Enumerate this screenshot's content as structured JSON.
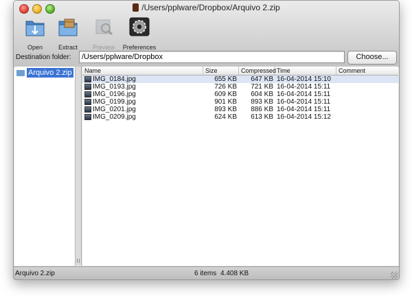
{
  "window": {
    "title": "/Users/pplware/Dropbox/Arquivo 2.zip"
  },
  "toolbar": {
    "open": "Open",
    "extract": "Extract",
    "preview": "Preview",
    "preferences": "Preferences"
  },
  "destination": {
    "label": "Destination folder:",
    "value": "/Users/pplware/Dropbox",
    "choose": "Choose..."
  },
  "sidebar": {
    "items": [
      {
        "label": "Arquivo 2.zip",
        "icon": "folder-icon"
      }
    ]
  },
  "columns": {
    "name": "Name",
    "size": "Size",
    "compressed": "Compressed",
    "time": "Time",
    "comment": "Comment"
  },
  "files": [
    {
      "name": "IMG_0184.jpg",
      "size": "655 KB",
      "compressed": "647 KB",
      "time": "16-04-2014 15:10",
      "comment": ""
    },
    {
      "name": "IMG_0193.jpg",
      "size": "726 KB",
      "compressed": "721 KB",
      "time": "16-04-2014 15:11",
      "comment": ""
    },
    {
      "name": "IMG_0196.jpg",
      "size": "609 KB",
      "compressed": "604 KB",
      "time": "16-04-2014 15:11",
      "comment": ""
    },
    {
      "name": "IMG_0199.jpg",
      "size": "901 KB",
      "compressed": "893 KB",
      "time": "16-04-2014 15:11",
      "comment": ""
    },
    {
      "name": "IMG_0201.jpg",
      "size": "893 KB",
      "compressed": "886 KB",
      "time": "16-04-2014 15:11",
      "comment": ""
    },
    {
      "name": "IMG_0209.jpg",
      "size": "624 KB",
      "compressed": "613 KB",
      "time": "16-04-2014 15:12",
      "comment": ""
    }
  ],
  "selected_row": 0,
  "status": {
    "archive": "Arquivo 2.zip",
    "count": "6 items",
    "total": "4.408 KB"
  },
  "colors": {
    "selection": "#3a73d4",
    "row_highlight": "#dbe5f5",
    "folder": "#6d9fd0"
  }
}
